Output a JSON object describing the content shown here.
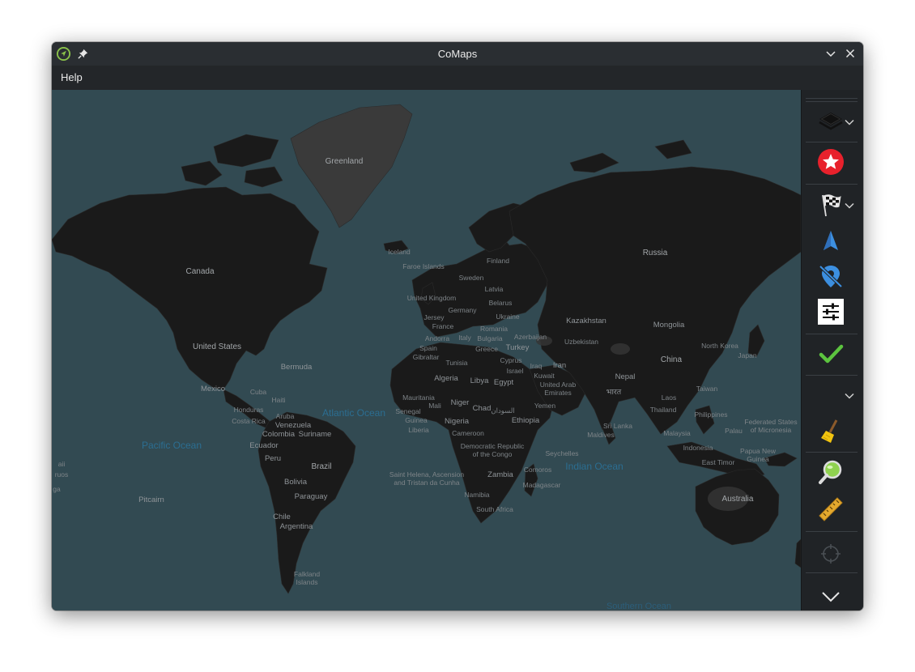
{
  "window": {
    "title": "CoMaps"
  },
  "menu": {
    "help": "Help"
  },
  "map": {
    "labels": {
      "greenland": "Greenland",
      "canada": "Canada",
      "united_states": "United States",
      "mexico": "Mexico",
      "cuba": "Cuba",
      "haiti": "Haiti",
      "honduras": "Honduras",
      "costa_rica": "Costa Rica",
      "aruba": "Aruba",
      "venezuela": "Venezuela",
      "colombia": "Colombia",
      "suriname": "Suriname",
      "ecuador": "Ecuador",
      "peru": "Peru",
      "brazil": "Brazil",
      "bolivia": "Bolivia",
      "paraguay": "Paraguay",
      "chile": "Chile",
      "argentina": "Argentina",
      "falkland": "Falkland\nIslands",
      "bermuda": "Bermuda",
      "pacific_ocean": "Pacific Ocean",
      "atlantic_ocean": "Atlantic Ocean",
      "indian_ocean": "Indian Ocean",
      "southern_ocean": "Southern Ocean",
      "pitcairn": "Pitcairn",
      "hawaii_left": "aii",
      "niue_left": "ruos",
      "tonga_left": "ga",
      "iceland": "Iceland",
      "faroe": "Faroe Islands",
      "norway": "Sweden",
      "finland": "Finland",
      "latvia": "Latvia",
      "belarus": "Belarus",
      "united_kingdom": "United Kingdom",
      "jersey": "Jersey",
      "germany": "Germany",
      "france": "France",
      "ukraine": "Ukraine",
      "romania": "Romania",
      "bulgaria": "Bulgaria",
      "andorra": "Andorra",
      "italy": "Italy",
      "spain": "Spain",
      "gibraltar": "Gibraltar",
      "greece": "Greece",
      "turkey": "Turkey",
      "azerbaijan": "Azerbaijan",
      "cyprus": "Cyprus",
      "israel": "Israel",
      "tunisia": "Tunisia",
      "algeria": "Algeria",
      "libya": "Libya",
      "egypt": "Egypt",
      "iraq": "Iraq",
      "iran": "Iran",
      "kuwait": "Kuwait",
      "uae": "United Arab\nEmirates",
      "yemen": "Yemen",
      "mauritania": "Mauritania",
      "mali": "Mali",
      "niger": "Niger",
      "chad": "Chad",
      "sudan": "السودان",
      "ethiopia": "Ethiopia",
      "senegal": "Senegal",
      "guinea": "Guinea",
      "liberia": "Liberia",
      "nigeria": "Nigeria",
      "cameroon": "Cameroon",
      "drc": "Democratic Republic\nof the Congo",
      "seychelles": "Seychelles",
      "comoros": "Comoros",
      "zambia": "Zambia",
      "madagascar": "Madagascar",
      "namibia": "Namibia",
      "south_africa": "South Africa",
      "st_helena": "Saint Helena, Ascension\nand Tristan da Cunha",
      "russia": "Russia",
      "kazakhstan": "Kazakhstan",
      "uzbekistan": "Uzbekistan",
      "mongolia": "Mongolia",
      "china": "China",
      "nepal": "Nepal",
      "india": "भारत",
      "north_korea": "North Korea",
      "japan": "Japan",
      "taiwan": "Taiwan",
      "laos": "Laos",
      "thailand": "Thailand",
      "philippines": "Philippines",
      "sri_lanka": "Sri Lanka",
      "maldives": "Maldives",
      "malaysia": "Malaysia",
      "indonesia": "Indonesia",
      "palau": "Palau",
      "micronesia": "Federated States\nof Micronesia",
      "png": "Papua New\nGuinea",
      "east_timor": "East Timor",
      "australia": "Australia"
    }
  },
  "toolbar": {
    "icons": [
      "layers-icon",
      "bookmarks-star-icon",
      "route-flag-icon",
      "my-location-arrow-icon",
      "location-off-icon",
      "settings-sliders-icon",
      "check-icon",
      "clear-broom-icon",
      "search-magnifier-icon",
      "ruler-icon",
      "crosshair-icon",
      "chevron-down-icon"
    ],
    "colors": {
      "star_red": "#e8212c",
      "check_green": "#5cc43f",
      "arrow_blue": "#3c8fe0"
    }
  }
}
